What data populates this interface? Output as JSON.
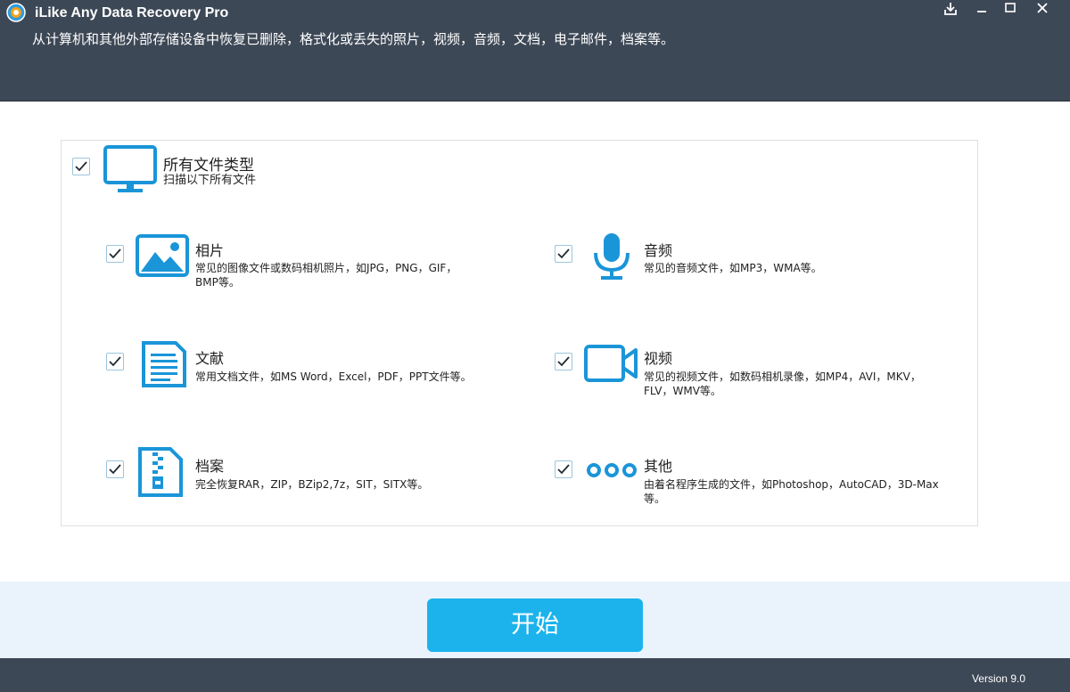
{
  "app": {
    "title": "iLike Any Data Recovery Pro",
    "subtitle": "从计算机和其他外部存储设备中恢复已删除，格式化或丢失的照片，视频，音频，文档，电子邮件，档案等。",
    "version": "Version 9.0"
  },
  "window_controls": [
    "download-icon",
    "minimize-icon",
    "maximize-icon",
    "close-icon"
  ],
  "all_types": {
    "checked": true,
    "icon": "monitor-icon",
    "title": "所有文件类型",
    "description": "扫描以下所有文件"
  },
  "categories": [
    {
      "key": "photos",
      "checked": true,
      "icon": "image-icon",
      "title": "相片",
      "desc_line1": "常见的图像文件或数码相机照片，如JPG，PNG，GIF，",
      "desc_line2": "BMP等。"
    },
    {
      "key": "audio",
      "checked": true,
      "icon": "microphone-icon",
      "title": "音频",
      "desc_line1": "常见的音频文件，如MP3，WMA等。",
      "desc_line2": ""
    },
    {
      "key": "documents",
      "checked": true,
      "icon": "document-icon",
      "title": "文献",
      "desc_line1": "常用文档文件，如MS Word，Excel，PDF，PPT文件等。",
      "desc_line2": ""
    },
    {
      "key": "video",
      "checked": true,
      "icon": "video-camera-icon",
      "title": "视频",
      "desc_line1": "常见的视频文件，如数码相机录像，如MP4，AVI，MKV，",
      "desc_line2": "FLV，WMV等。"
    },
    {
      "key": "archives",
      "checked": true,
      "icon": "zip-archive-icon",
      "title": "档案",
      "desc_line1": "完全恢复RAR，ZIP，BZip2,7z，SIT，SITX等。",
      "desc_line2": ""
    },
    {
      "key": "other",
      "checked": true,
      "icon": "more-dots-icon",
      "title": "其他",
      "desc_line1": "由着名程序生成的文件，如Photoshop，AutoCAD，3D-Max",
      "desc_line2": "等。"
    }
  ],
  "start_button": {
    "label": "开始"
  },
  "colors": {
    "header_bg": "#3d4856",
    "accent": "#1cb3ec",
    "icon_blue": "#1a95d8",
    "footer_band": "#eaf3fb"
  }
}
